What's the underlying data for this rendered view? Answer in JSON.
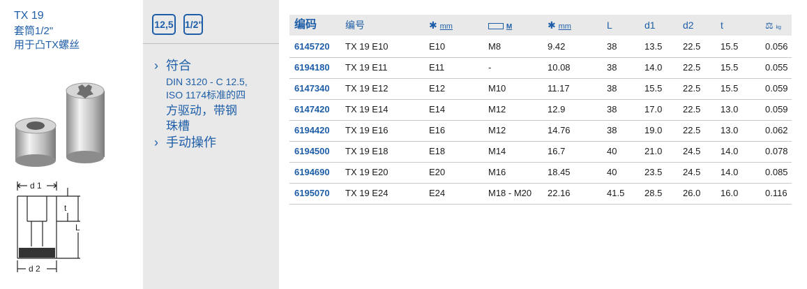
{
  "product": {
    "title": "TX 19",
    "line1": "套筒1/2\"",
    "line2": "用于凸TX螺丝"
  },
  "badges": [
    "12,5",
    "1/2\""
  ],
  "features": {
    "item1_title": "符合",
    "item1_l1": "DIN 3120 - C 12.5,",
    "item1_l2": "ISO 1174标准的四",
    "item1_l3": "方驱动，带钢",
    "item1_l4": "珠槽",
    "item2": "手动操作"
  },
  "diagram_labels": {
    "d1": "d 1",
    "d2": "d 2",
    "t": "t",
    "L": "L"
  },
  "table": {
    "headers": [
      "编码",
      "编号",
      "mm",
      "M",
      "mm",
      "L",
      "d1",
      "d2",
      "t",
      "kg"
    ],
    "rows": [
      [
        "6145720",
        "TX 19 E10",
        "E10",
        "M8",
        "9.42",
        "38",
        "13.5",
        "22.5",
        "15.5",
        "0.056"
      ],
      [
        "6194180",
        "TX 19 E11",
        "E11",
        "-",
        "10.08",
        "38",
        "14.0",
        "22.5",
        "15.5",
        "0.055"
      ],
      [
        "6147340",
        "TX 19 E12",
        "E12",
        "M10",
        "11.17",
        "38",
        "15.5",
        "22.5",
        "15.5",
        "0.059"
      ],
      [
        "6147420",
        "TX 19 E14",
        "E14",
        "M12",
        "12.9",
        "38",
        "17.0",
        "22.5",
        "13.0",
        "0.059"
      ],
      [
        "6194420",
        "TX 19 E16",
        "E16",
        "M12",
        "14.76",
        "38",
        "19.0",
        "22.5",
        "13.0",
        "0.062"
      ],
      [
        "6194500",
        "TX 19 E18",
        "E18",
        "M14",
        "16.7",
        "40",
        "21.0",
        "24.5",
        "14.0",
        "0.078"
      ],
      [
        "6194690",
        "TX 19 E20",
        "E20",
        "M16",
        "18.45",
        "40",
        "23.5",
        "24.5",
        "14.0",
        "0.085"
      ],
      [
        "6195070",
        "TX 19 E24",
        "E24",
        "M18 - M20",
        "22.16",
        "41.5",
        "28.5",
        "26.0",
        "16.0",
        "0.116"
      ]
    ]
  },
  "colors": {
    "accent": "#1e5ea8",
    "panel": "#e9e9e9"
  }
}
